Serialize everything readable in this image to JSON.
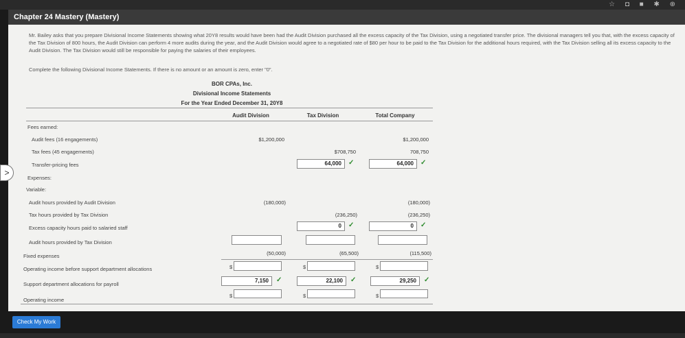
{
  "header": {
    "title": "Chapter 24 Mastery (Mastery)"
  },
  "window": {
    "icons": "☆ ◘ ■ ✱ ⊕"
  },
  "description": "Mr. Bailey asks that you prepare Divisional Income Statements showing what 20Y8 results would have been had the Audit Division purchased all the excess capacity of the Tax Division, using a negotiated transfer price. The divisional managers tell you that, with the excess capacity of the Tax Division of 800 hours, the Audit Division can perform 4 more audits during the year, and the Audit Division would agree to a negotiated rate of $80 per hour to be paid to the Tax Division for the additional hours required, with the Tax Division selling all its excess capacity to the Audit Division. The Tax Division would still be responsible for paying the salaries of their employees.",
  "instruction": "Complete the following Divisional Income Statements. If there is no amount or an amount is zero, enter \"0\".",
  "statement": {
    "company": "BOR CPAs, Inc.",
    "name": "Divisional Income Statements",
    "period": "For the Year Ended December 31, 20Y8",
    "columns": [
      "Audit Division",
      "Tax Division",
      "Total Company"
    ]
  },
  "rows": {
    "fees_earned": "Fees earned:",
    "audit_fees": "Audit fees (16 engagements)",
    "tax_fees": "Tax fees (45 engagements)",
    "transfer_fees": "Transfer-pricing fees",
    "expenses": "Expenses:",
    "variable": "Variable:",
    "audit_hours_audit": "Audit hours provided by Audit Division",
    "tax_hours_tax": "Tax hours provided by Tax Division",
    "excess_capacity": "Excess capacity hours paid to salaried staff",
    "audit_hours_tax": "Audit hours provided by Tax Division",
    "fixed": "Fixed expenses",
    "op_before": "Operating income before support department allocations",
    "support": "Support department allocations for payroll",
    "op_income": "Operating income"
  },
  "values": {
    "audit_fees_audit": "$1,200,000",
    "audit_fees_total": "$1,200,000",
    "tax_fees_tax": "$708,750",
    "tax_fees_total": "708,750",
    "transfer_tax": "64,000",
    "transfer_total": "64,000",
    "audit_hours_audit": "(180,000)",
    "audit_hours_total": "(180,000)",
    "tax_hours_tax": "(236,250)",
    "tax_hours_total": "(236,250)",
    "excess_tax": "0",
    "excess_total": "0",
    "fixed_audit": "(50,000)",
    "fixed_tax": "(65,500)",
    "fixed_total": "(115,500)",
    "support_audit": "7,150",
    "support_tax": "22,100",
    "support_total": "29,250"
  },
  "symbols": {
    "check": "✓",
    "dollar": "$",
    "nav": ">"
  },
  "button": {
    "check_my_work": "Check My Work"
  }
}
